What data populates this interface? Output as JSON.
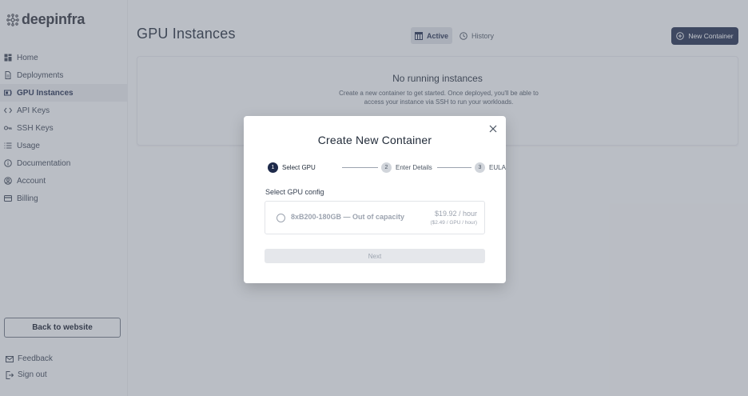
{
  "brand": {
    "name": "deepinfra"
  },
  "sidebar": {
    "items": [
      {
        "label": "Home",
        "icon": "grid-icon"
      },
      {
        "label": "Deployments",
        "icon": "document-icon"
      },
      {
        "label": "GPU Instances",
        "icon": "gpu-icon",
        "active": true
      },
      {
        "label": "API Keys",
        "icon": "code-icon"
      },
      {
        "label": "SSH Keys",
        "icon": "key-icon"
      },
      {
        "label": "Usage",
        "icon": "list-icon"
      },
      {
        "label": "Documentation",
        "icon": "info-icon"
      },
      {
        "label": "Account",
        "icon": "user-circle-icon"
      },
      {
        "label": "Billing",
        "icon": "credit-card-icon"
      }
    ],
    "back_label": "Back to website",
    "feedback_label": "Feedback",
    "signout_label": "Sign out"
  },
  "header": {
    "title": "GPU Instances",
    "tabs": [
      {
        "label": "Active",
        "icon": "table-icon",
        "active": true
      },
      {
        "label": "History",
        "icon": "clock-icon"
      }
    ],
    "new_button_label": "New Container"
  },
  "empty_state": {
    "title": "No running instances",
    "description": "Create a new container to get started. Once deployed, you'll be able to access your instance via SSH to run your workloads."
  },
  "modal": {
    "title": "Create New Container",
    "steps": [
      {
        "num": "1",
        "label": "Select GPU",
        "active": true
      },
      {
        "num": "2",
        "label": "Enter Details"
      },
      {
        "num": "3",
        "label": "EULA"
      }
    ],
    "section_label": "Select GPU config",
    "gpu_option": {
      "name": "8xB200-180GB — Out of capacity",
      "price": "$19.92 / hour",
      "price_detail": "($2.49 / GPU / hour)",
      "selected": false,
      "disabled": true
    },
    "next_label": "Next"
  },
  "colors": {
    "accent": "#1e2a4a",
    "background": "#f3f4f6",
    "overlay": "rgba(107,114,128,0.42)"
  }
}
